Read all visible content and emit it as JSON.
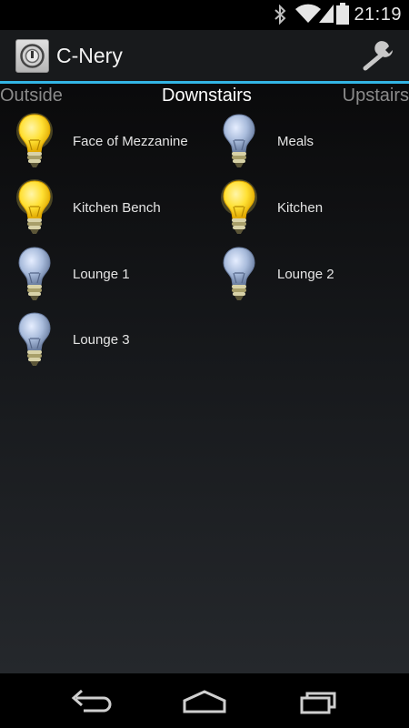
{
  "status_bar": {
    "time": "21:19",
    "icons": [
      "bluetooth-icon",
      "wifi-icon",
      "signal-icon",
      "battery-icon"
    ]
  },
  "app": {
    "title": "C-Nery",
    "icon": "app-logo-icon",
    "settings_icon": "wrench-icon"
  },
  "accent_color": "#33b5e5",
  "tabs": {
    "left": "Outside",
    "current": "Downstairs",
    "right": "Upstairs"
  },
  "lights": [
    {
      "label": "Face of Mezzanine",
      "state": "on"
    },
    {
      "label": "Meals",
      "state": "off"
    },
    {
      "label": "Kitchen Bench",
      "state": "on"
    },
    {
      "label": "Kitchen",
      "state": "on"
    },
    {
      "label": "Lounge 1",
      "state": "off"
    },
    {
      "label": "Lounge 2",
      "state": "off"
    },
    {
      "label": "Lounge 3",
      "state": "off"
    }
  ],
  "nav": [
    "back-icon",
    "home-icon",
    "recent-apps-icon"
  ]
}
